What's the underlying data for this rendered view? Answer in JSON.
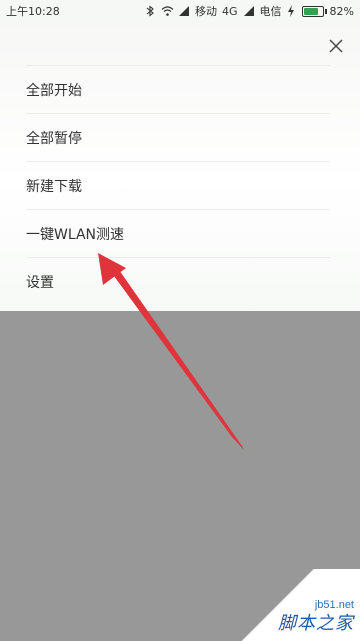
{
  "status_bar": {
    "time": "上午10:28",
    "carrier1": "移动",
    "network": "4G",
    "carrier2": "电信",
    "battery_percent": "82%",
    "battery_level": 0.82,
    "icons": [
      "bluetooth-icon",
      "wifi-icon",
      "signal-icon",
      "charging-icon",
      "battery-icon"
    ]
  },
  "menu": {
    "close_icon": "close-icon",
    "items": [
      {
        "label": "全部开始"
      },
      {
        "label": "全部暂停"
      },
      {
        "label": "新建下载"
      },
      {
        "label": "一键WLAN测速"
      },
      {
        "label": "设置"
      }
    ]
  },
  "annotation": {
    "color": "#e0343c"
  },
  "watermark": {
    "url": "jb51.net",
    "brand": "脚本之家"
  }
}
